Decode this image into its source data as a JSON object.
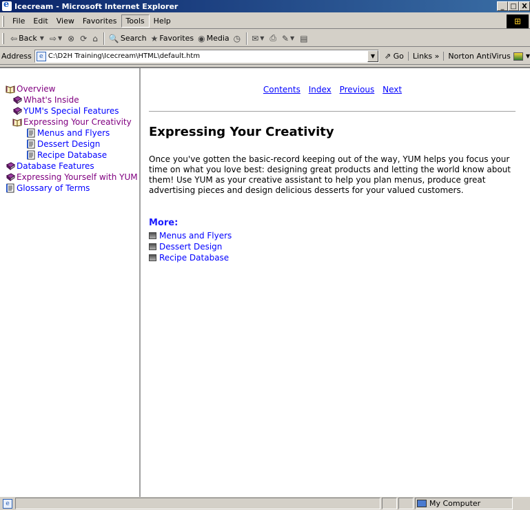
{
  "window": {
    "title": "Icecream - Microsoft Internet Explorer"
  },
  "window_buttons": {
    "minimize": "_",
    "maximize": "□",
    "close": "X"
  },
  "menu": {
    "items": [
      "File",
      "Edit",
      "View",
      "Favorites",
      "Tools",
      "Help"
    ],
    "active": "Tools"
  },
  "toolbar": {
    "back": "Back",
    "search": "Search",
    "favorites": "Favorites",
    "media": "Media"
  },
  "address": {
    "label": "Address",
    "value": "C:\\D2H Training\\Icecream\\HTML\\default.htm",
    "go": "Go",
    "links": "Links",
    "norton": "Norton AntiVirus"
  },
  "toc": {
    "items": [
      {
        "label": "Overview",
        "level": 1,
        "icon": "open-book-icon",
        "visited": true
      },
      {
        "label": "What's Inside",
        "level": 2,
        "icon": "closed-book-icon",
        "visited": true
      },
      {
        "label": "YUM's Special Features",
        "level": 2,
        "icon": "closed-book-icon",
        "visited": false
      },
      {
        "label": "Expressing Your Creativity",
        "level": 2,
        "icon": "open-book-icon",
        "visited": true
      },
      {
        "label": "Menus and Flyers",
        "level": 3,
        "icon": "page-icon",
        "visited": false
      },
      {
        "label": "Dessert Design",
        "level": 3,
        "icon": "page-icon",
        "visited": false
      },
      {
        "label": "Recipe Database",
        "level": 3,
        "icon": "page-icon",
        "visited": false
      },
      {
        "label": "Database Features",
        "level": 1,
        "icon": "closed-book-icon",
        "visited": false
      },
      {
        "label": "Expressing Yourself with YUM",
        "level": 1,
        "icon": "closed-book-icon",
        "visited": true
      },
      {
        "label": "Glossary of Terms",
        "level": 1,
        "icon": "page-icon",
        "visited": false
      }
    ]
  },
  "main": {
    "nav": [
      "Contents",
      "Index",
      "Previous",
      "Next"
    ],
    "heading": "Expressing Your Creativity",
    "paragraph": "Once you've gotten the basic-record keeping out of the way, YUM helps you focus your time on what you love best: designing great products and letting the world know about them! Use YUM as your creative assistant to help you plan menus, produce great advertising pieces and design delicious desserts for your valued customers.",
    "more_title": "More:",
    "more_links": [
      "Menus and Flyers",
      "Dessert Design",
      "Recipe Database"
    ]
  },
  "status": {
    "zone": "My Computer"
  },
  "colors": {
    "link": "#0000ff",
    "visited": "#800080",
    "titlebar": "#0a246a",
    "more_title": "#1a1aff"
  }
}
